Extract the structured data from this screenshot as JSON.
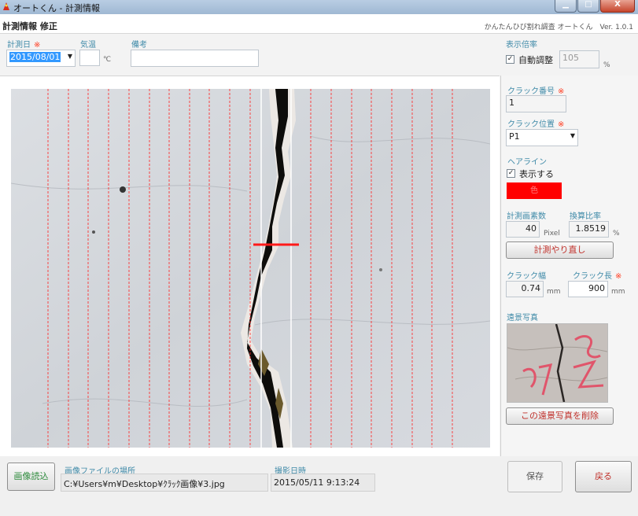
{
  "window": {
    "title": "オートくん - 計測情報",
    "minimize_glyph": "▁",
    "maximize_glyph": "□",
    "close_glyph": "X"
  },
  "header": {
    "screen_title": "計測情報 修正",
    "app_version": "かんたんひび割れ調査 オートくん　Ver. 1.0.1"
  },
  "form": {
    "date_label": "計測日",
    "date_value": "2015/08/01",
    "temp_label": "気温",
    "temp_value": "",
    "temp_unit": "℃",
    "remarks_label": "備考",
    "remarks_value": "",
    "required_mark": "※"
  },
  "zoom": {
    "label": "表示倍率",
    "auto_label": "自動調整",
    "auto_checked": true,
    "value": "105",
    "unit": "%"
  },
  "side": {
    "crack_no_label": "クラック番号",
    "crack_no_value": "1",
    "crack_pos_label": "クラック位置",
    "crack_pos_value": "P1",
    "hairline_label": "ヘアライン",
    "show_label": "表示する",
    "show_checked": true,
    "color_label": "色",
    "pixel_count_label": "計測画素数",
    "pixel_count_value": "40",
    "pixel_unit": "Pixel",
    "ratio_label": "換算比率",
    "ratio_value": "1.8519",
    "ratio_unit": "%",
    "remeasure_button": "計測やり直し",
    "width_label": "クラック幅",
    "width_value": "0.74",
    "width_unit": "mm",
    "length_label": "クラック長",
    "length_value": "900",
    "length_unit": "mm",
    "distant_photo_label": "遠景写真",
    "delete_photo_button": "この遠景写真を削除"
  },
  "footer": {
    "load_image_button": "画像読込",
    "file_location_label": "画像ファイルの場所",
    "file_path": "C:¥Users¥m¥Desktop¥ｸﾗｯｸ画像¥3.jpg",
    "shot_date_label": "撮影日時",
    "shot_date_value": "2015/05/11 9:13:24",
    "save_button": "保存",
    "back_button": "戻る"
  },
  "colors": {
    "label_accent": "#3f8aa8",
    "required_mark": "#ff3b1f",
    "hairline": "#ff0000",
    "button_text": "#c0302a",
    "selection": "#3399ff"
  }
}
